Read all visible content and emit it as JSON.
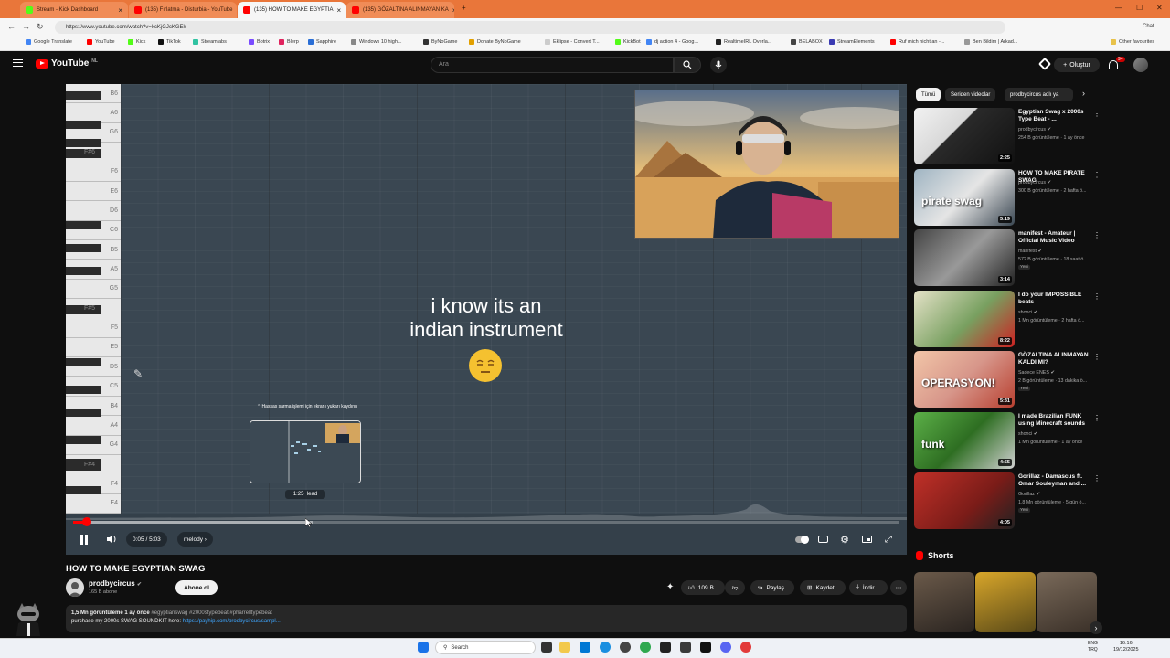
{
  "browser": {
    "tabs": [
      {
        "title": "Stream - Kick Dashboard",
        "color": "#53fc18"
      },
      {
        "title": "(135) Fırlatma - Disturbia - YouTube",
        "color": "#ff0000"
      },
      {
        "title": "(135) HOW TO MAKE EGYPTIA",
        "color": "#ff0000"
      },
      {
        "title": "(135) GÖZALTINA ALINMAYAN KA",
        "color": "#ff0000"
      }
    ],
    "url": "https://www.youtube.com/watch?v=kcKjGJcKGEk",
    "bookmarks": [
      {
        "label": "Google Translate",
        "color": "#4285f4"
      },
      {
        "label": "YouTube",
        "color": "#ff0000"
      },
      {
        "label": "Kick",
        "color": "#53fc18"
      },
      {
        "label": "TikTok",
        "color": "#111111"
      },
      {
        "label": "Streamlabs",
        "color": "#31c3a2"
      },
      {
        "label": "Botrix",
        "color": "#7a4cff"
      },
      {
        "label": "Blerp",
        "color": "#e0245e"
      },
      {
        "label": "Sapphire",
        "color": "#2b6fd6"
      },
      {
        "label": "Windows 10 high...",
        "color": "#888888"
      },
      {
        "label": "ByNoGame",
        "color": "#333333"
      },
      {
        "label": "Donate ByNoGame",
        "color": "#e2a000"
      },
      {
        "label": "Eklipse - Convert T...",
        "color": "#cccccc"
      },
      {
        "label": "KickBot",
        "color": "#53fc18"
      },
      {
        "label": "dj action 4 - Goog...",
        "color": "#4285f4"
      },
      {
        "label": "RealtimeIRL Overla...",
        "color": "#222222"
      },
      {
        "label": "BELABOX",
        "color": "#444444"
      },
      {
        "label": "StreamElements",
        "color": "#3b3bb3"
      },
      {
        "label": "Ruf mich nicht an -...",
        "color": "#ff0000"
      },
      {
        "label": "Ben Bildim | Arkad...",
        "color": "#999999"
      }
    ],
    "other_favourites": "Other favourites"
  },
  "youtube": {
    "logo_text": "YouTube",
    "logo_country": "NL",
    "search_placeholder": "Ara",
    "create_label": "Oluştur",
    "notif_count": "9+"
  },
  "player": {
    "piano_labels": [
      "B6",
      "A6",
      "G6",
      "F#6",
      "F6",
      "E6",
      "D6",
      "C6",
      "B5",
      "A5",
      "G5",
      "F#5",
      "F5",
      "E5",
      "D5",
      "C5",
      "B4",
      "A4",
      "G4",
      "F#4",
      "F4",
      "E4"
    ],
    "caption_line1": "i know its an",
    "caption_line2": "indian instrument",
    "preview_tip": "Hassas sarma işlemi için ekranı yukarı kaydırın",
    "preview_time": "1:25",
    "preview_chapter": "lead",
    "time": "0:05 / 5:03",
    "chapter": "melody",
    "progress_fraction": 0.017,
    "buffer_fraction": 0.29
  },
  "video": {
    "title": "HOW TO MAKE EGYPTIAN SWAG",
    "channel": "prodbycircus",
    "subscribers": "165 B abone",
    "subscribe_label": "Abone ol",
    "likes": "109 B",
    "share_label": "Paylaş",
    "save_label": "Kaydet",
    "download_label": "İndir",
    "stats_line": "1,5 Mn görüntüleme  1 ay önce",
    "hashtags": "#egyptianswag #2000stypebeat #pharrelltypebeat",
    "desc_text": "purchase my 2000s SWAG SOUNDKIT here: ",
    "desc_link": "https://payhip.com/prodbycircus/sampl..."
  },
  "sidebar": {
    "chips": [
      "Tümü",
      "Seriden videolar",
      "prodbycircus adlı ya"
    ],
    "recommendations": [
      {
        "title": "Egyptian Swag x 2000s Type Beat - ...",
        "channel": "prodbycircus",
        "meta": "254 B görüntüleme · 1 ay önce",
        "duration": "2:25",
        "overlay": "",
        "new": ""
      },
      {
        "title": "HOW TO MAKE PIRATE SWAG",
        "channel": "prodbycircus",
        "meta": "300 B görüntüleme · 2 hafta ö...",
        "duration": "5:19",
        "overlay": "pirate swag",
        "new": ""
      },
      {
        "title": "manifest - Amateur | Official Music Video",
        "channel": "manifest",
        "meta": "572 B görüntüleme · 18 saat ö...",
        "duration": "3:14",
        "overlay": "",
        "new": "Yeni"
      },
      {
        "title": "I do your IMPOSSIBLE beats",
        "channel": "shonci",
        "meta": "1 Mn görüntüleme · 2 hafta ö...",
        "duration": "8:22",
        "overlay": "",
        "new": ""
      },
      {
        "title": "GÖZALTINA ALINMAYAN KALDI MI?",
        "channel": "Sadece ENES",
        "meta": "2 B görüntüleme · 13 dakika ö...",
        "duration": "5:31",
        "overlay": "OPERASYON!",
        "new": "Yeni"
      },
      {
        "title": "I made Brazilian FUNK using Minecraft sounds",
        "channel": "shonci",
        "meta": "1 Mn görüntüleme · 1 ay önce",
        "duration": "4:55",
        "overlay": "funk",
        "new": ""
      },
      {
        "title": "Gorillaz - Damascus ft. Omar Souleyman and ...",
        "channel": "Gorillaz",
        "meta": "1,8 Mn görüntüleme · 5 gün ö...",
        "duration": "4:05",
        "overlay": "",
        "new": "Yeni"
      }
    ],
    "shorts_title": "Shorts"
  },
  "taskbar": {
    "search_label": "Search",
    "lang_line1": "ENG",
    "lang_line2": "TRQ",
    "time": "16:16",
    "date": "19/12/2025"
  }
}
